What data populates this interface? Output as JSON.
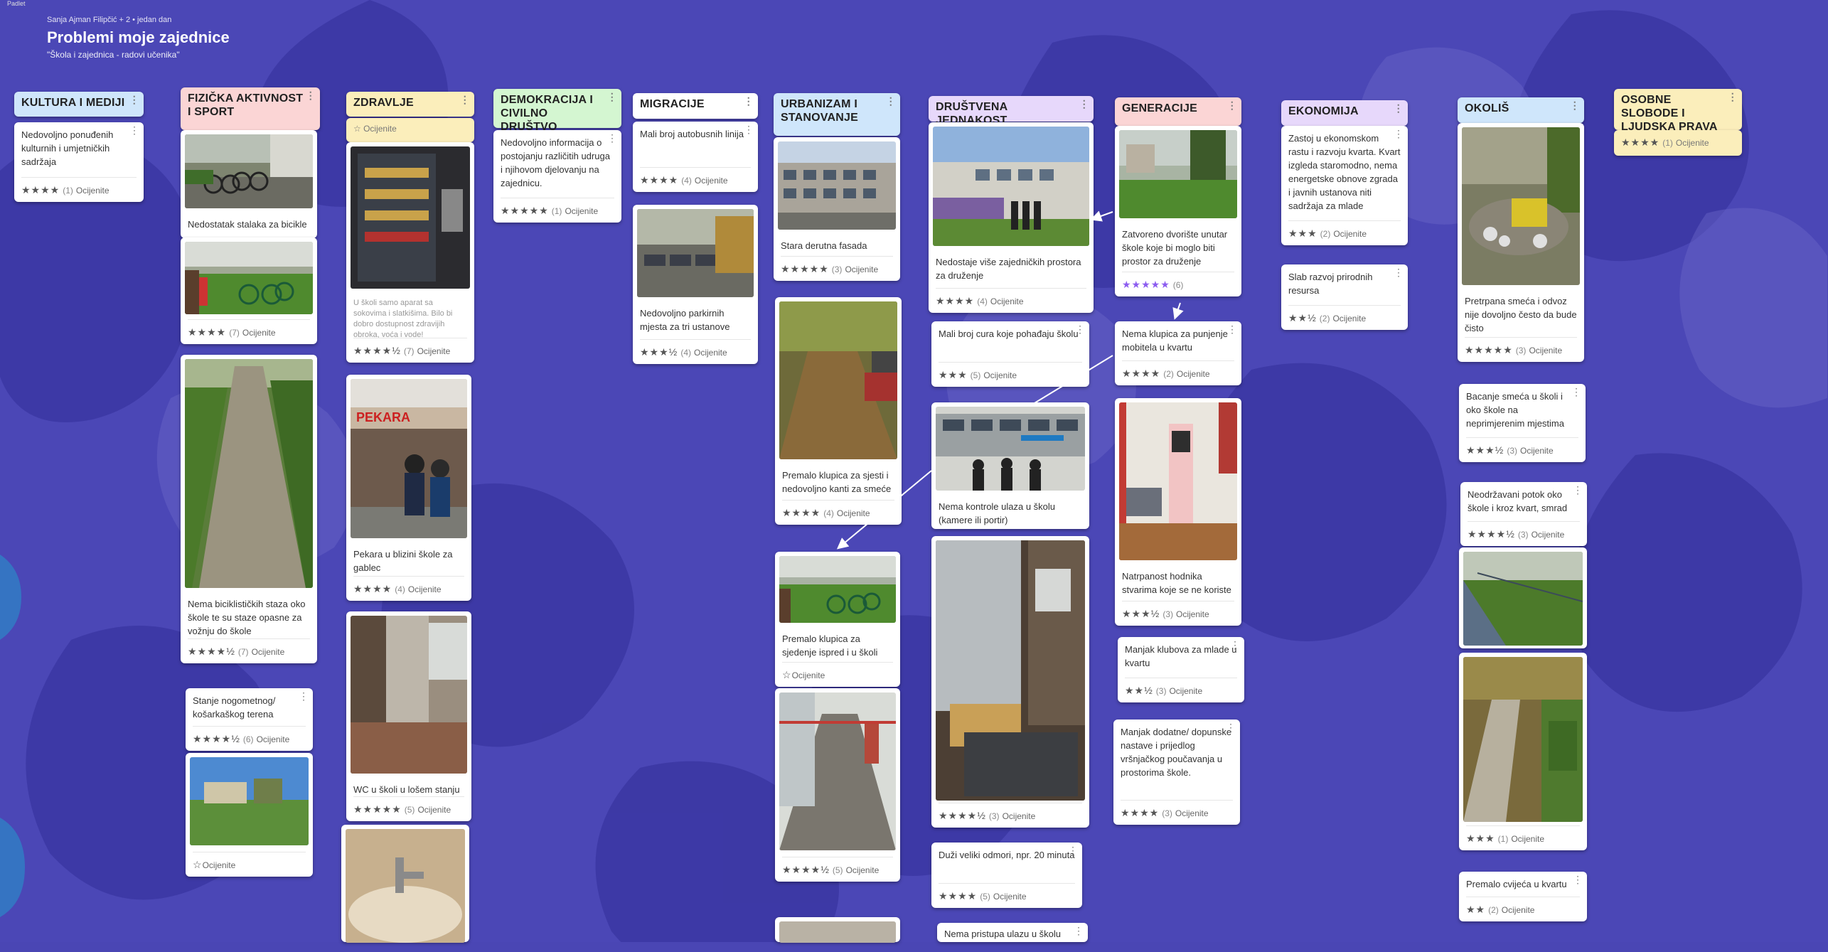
{
  "board": {
    "corner": "Padlet",
    "authors": "Sanja Ajman Filipčić + 2 • jedan dan",
    "title": "Problemi moje zajednice",
    "subtitle": "\"Škola i zajednica - radovi učenika\""
  },
  "rate_label": "Ocijenite",
  "colors": {
    "background": "#4a46b4",
    "head_blue": "#cfe6fb",
    "head_pink": "#fbd5d5",
    "head_yellow": "#fbeebb",
    "head_green": "#d4f6d1",
    "head_purple": "#e7d8fb",
    "star_purple": "#8c5cf0"
  },
  "columns": [
    {
      "title": "KULTURA I MEDIJI",
      "cards": [
        {
          "text": "Nedovoljno ponuđenih kulturnih i umjetničkih sadržaja",
          "rating_count": "(1)",
          "rating_value": 4
        }
      ]
    },
    {
      "title": "FIZIČKA AKTIVNOST I SPORT",
      "cards": [
        {
          "text": "Nedostatak stalaka za bicikle",
          "image": "bike-rack-photo"
        },
        {
          "image": "bikes-lawn-photo",
          "rating_count": "(7)",
          "rating_value": 4
        },
        {
          "text": "Nema biciklističkih staza oko škole te su staze opasne za vožnju do škole",
          "image": "path-photo",
          "rating_count": "(7)",
          "rating_value": 4.5
        },
        {
          "text": "Stanje nogometnog/ košarkaškog terena",
          "rating_count": "(6)",
          "rating_value": 4.5
        },
        {
          "image": "field-photo",
          "rating_count": "",
          "rating_value": 0
        }
      ]
    },
    {
      "title": "ZDRAVLJE",
      "cards": [
        {
          "text": "U školi samo aparat sa sokovima i slatkišima. Bilo bi dobro dostupnost zdravijih obroka, voća i vode!",
          "image": "vending-photo",
          "rating_count": "(7)",
          "rating_value": 4.5
        },
        {
          "text": "Pekara u blizini škole za gablec",
          "image": "bakery-photo",
          "rating_count": "(4)",
          "rating_value": 4
        },
        {
          "text": "WC u školi u lošem stanju",
          "image": "wc-photo",
          "rating_count": "(5)",
          "rating_value": 5
        },
        {
          "image": "sink-photo"
        }
      ]
    },
    {
      "title": "DEMOKRACIJA I CIVILNO DRUŠTVO",
      "cards": [
        {
          "text": "Nedovoljno informacija o postojanju različitih udruga i njihovom djelovanju na zajednicu.",
          "rating_count": "(1)",
          "rating_value": 5
        }
      ]
    },
    {
      "title": "MIGRACIJE",
      "cards": [
        {
          "text": "Mali broj autobusnih linija",
          "rating_count": "(4)",
          "rating_value": 4
        },
        {
          "text": "Nedovoljno parkirnih mjesta za tri ustanove",
          "image": "parking-photo",
          "rating_count": "(4)",
          "rating_value": 3.5
        }
      ]
    },
    {
      "title": "URBANIZAM I STANOVANJE",
      "cards": [
        {
          "text": "Stara derutna fasada",
          "image": "facade-photo",
          "rating_count": "(3)",
          "rating_value": 5
        },
        {
          "text": "Premalo klupica za sjesti i nedovoljno kanti za smeće",
          "image": "autumn-street-photo",
          "rating_count": "(4)",
          "rating_value": 4
        },
        {
          "text": "Premalo klupica za sjedenje ispred i u školi",
          "image": "bench-photo",
          "rating_count": "",
          "rating_value": 0
        },
        {
          "image": "hallway-photo",
          "rating_count": "(5)",
          "rating_value": 4.5
        },
        {
          "image": "partial-photo"
        }
      ]
    },
    {
      "title": "DRUŠTVENA JEDNAKOST",
      "cards": [
        {
          "text": "Nedostaje više zajedničkih prostora za druženje",
          "image": "graffiti-photo",
          "rating_count": "(4)",
          "rating_value": 4
        },
        {
          "text": "Mali broj cura koje pohađaju školu",
          "rating_count": "(5)",
          "rating_value": 3
        },
        {
          "text": "Nema kontrole ulaza u školu (kamere ili portir)",
          "image": "entrance-photo"
        },
        {
          "image": "door-photo",
          "rating_count": "(3)",
          "rating_value": 4.5
        },
        {
          "text": "Duži veliki odmori, npr. 20 minuta",
          "rating_count": "(5)",
          "rating_value": 4
        },
        {
          "text": "Nema pristupa ulazu u školu"
        }
      ]
    },
    {
      "title": "GENERACIJE",
      "cards": [
        {
          "text": "Zatvoreno dvorište unutar škole koje bi moglo biti prostor za druženje",
          "image": "yard-photo",
          "rating_count": "(6)",
          "rating_value": 5
        },
        {
          "text": "Nema klupica za punjenje mobitela u kvartu",
          "rating_count": "(2)",
          "rating_value": 4
        },
        {
          "text": "Natrpanost hodnika stvarima koje se ne koriste",
          "image": "kiosk-photo",
          "rating_count": "(3)",
          "rating_value": 3.5
        },
        {
          "text": "Manjak klubova za mlade u kvartu",
          "rating_count": "(3)",
          "rating_value": 2.5
        },
        {
          "text": "Manjak dodatne/ dopunske nastave i prijedlog vršnjačkog poučavanja u prostorima škole.",
          "rating_count": "(3)",
          "rating_value": 4
        }
      ]
    },
    {
      "title": "EKONOMIJA",
      "cards": [
        {
          "text": "Zastoj u ekonomskom rastu i razvoju kvarta. Kvart izgleda staromodno, nema energetske obnove zgrada i javnih ustanova niti sadržaja za mlade",
          "rating_count": "(2)",
          "rating_value": 3
        },
        {
          "text": "Slab razvoj prirodnih resursa",
          "rating_count": "(2)",
          "rating_value": 2.5
        }
      ]
    },
    {
      "title": "OKOLIŠ",
      "cards": [
        {
          "text": "Pretrpana smeća i odvoz nije dovoljno često da bude čisto",
          "image": "trash-photo",
          "rating_count": "(3)",
          "rating_value": 5
        },
        {
          "text": "Bacanje smeća u školi i oko škole na neprimjerenim mjestima",
          "rating_count": "(3)",
          "rating_value": 3.5
        },
        {
          "text": "Neodržavani potok oko škole i kroz kvart, smrad",
          "rating_count": "(3)",
          "rating_value": 4.5
        },
        {
          "image": "stream-photo"
        },
        {
          "image": "leaves-path-photo",
          "rating_count": "(1)",
          "rating_value": 3
        },
        {
          "text": "Premalo cvijeća u kvartu",
          "rating_count": "(2)",
          "rating_value": 2
        }
      ]
    },
    {
      "title": "OSOBNE SLOBODE I LJUDSKA PRAVA",
      "cards": [
        {
          "rating_count": "(1)",
          "rating_value": 4
        }
      ]
    }
  ]
}
